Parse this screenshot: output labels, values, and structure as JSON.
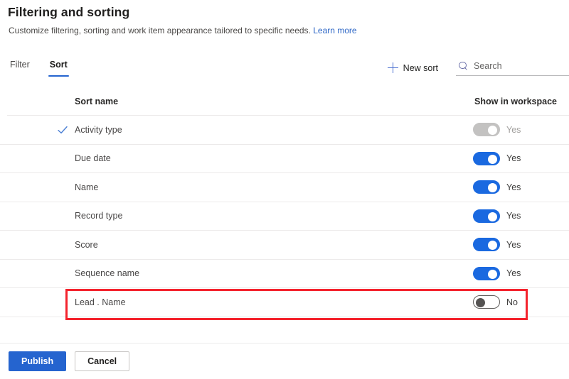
{
  "header": {
    "title": "Filtering and sorting",
    "subtitle": "Customize filtering, sorting and work item appearance tailored to specific needs.",
    "learn_more": "Learn more"
  },
  "tabs": [
    {
      "label": "Filter",
      "active": false
    },
    {
      "label": "Sort",
      "active": true
    }
  ],
  "commands": {
    "new_sort_label": "New sort",
    "plus_icon": "plus-icon",
    "search_icon": "search-icon",
    "search_placeholder": "Search",
    "search_value": ""
  },
  "table": {
    "columns": {
      "name": "Sort name",
      "show": "Show in workspace"
    },
    "rows": [
      {
        "name": "Activity type",
        "checked": true,
        "toggle": "on",
        "toggle_label": "Yes",
        "disabled": true,
        "highlighted": false
      },
      {
        "name": "Due date",
        "checked": false,
        "toggle": "on",
        "toggle_label": "Yes",
        "disabled": false,
        "highlighted": false
      },
      {
        "name": "Name",
        "checked": false,
        "toggle": "on",
        "toggle_label": "Yes",
        "disabled": false,
        "highlighted": false
      },
      {
        "name": "Record type",
        "checked": false,
        "toggle": "on",
        "toggle_label": "Yes",
        "disabled": false,
        "highlighted": false
      },
      {
        "name": "Score",
        "checked": false,
        "toggle": "on",
        "toggle_label": "Yes",
        "disabled": false,
        "highlighted": false
      },
      {
        "name": "Sequence name",
        "checked": false,
        "toggle": "on",
        "toggle_label": "Yes",
        "disabled": false,
        "highlighted": false
      },
      {
        "name": "Lead . Name",
        "checked": false,
        "toggle": "off",
        "toggle_label": "No",
        "disabled": false,
        "highlighted": true
      }
    ]
  },
  "footer": {
    "publish_label": "Publish",
    "cancel_label": "Cancel"
  },
  "colors": {
    "accent": "#2564cf",
    "toggle_on": "#1a69e0",
    "toggle_disabled": "#c3c2c1",
    "annotation": "#f4232d",
    "link": "#2a64c5"
  }
}
